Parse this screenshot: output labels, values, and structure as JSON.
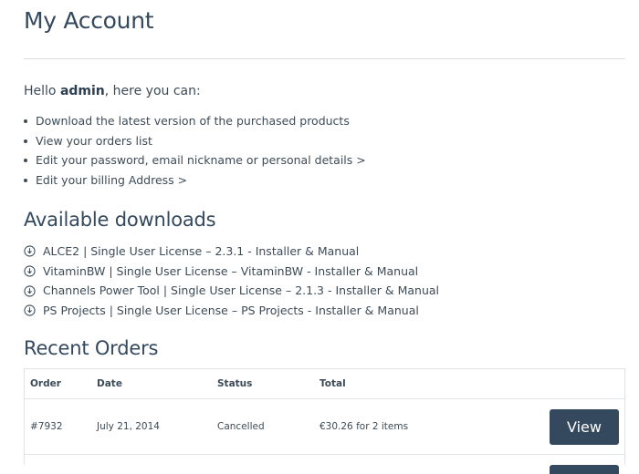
{
  "page_title": "My Account",
  "greeting": {
    "prefix": "Hello ",
    "username": "admin",
    "suffix": ", here you can:"
  },
  "account_links": [
    {
      "label": "Download the latest version of the purchased products"
    },
    {
      "label": "View your orders list"
    },
    {
      "label": "Edit your password, email nickname or personal details >"
    },
    {
      "label": "Edit your billing Address >"
    }
  ],
  "downloads": {
    "title": "Available downloads",
    "icon": "download-circle-icon",
    "items": [
      {
        "label": "ALCE2 | Single User License – 2.3.1 - Installer & Manual"
      },
      {
        "label": "VitaminBW | Single User License – VitaminBW - Installer & Manual"
      },
      {
        "label": "Channels Power Tool | Single User License – 2.1.3 - Installer & Manual"
      },
      {
        "label": "PS Projects | Single User License – PS Projects - Installer & Manual"
      }
    ]
  },
  "recent_orders": {
    "title": "Recent Orders",
    "columns": {
      "order": "Order",
      "date": "Date",
      "status": "Status",
      "total": "Total"
    },
    "rows": [
      {
        "order": "#7932",
        "date": "July 21, 2014",
        "status": "Cancelled",
        "total": "€30.26 for 2 items",
        "action": "View"
      }
    ]
  },
  "colors": {
    "accent": "#34495e",
    "text": "#3d4b57",
    "border": "#e1e4e6"
  }
}
